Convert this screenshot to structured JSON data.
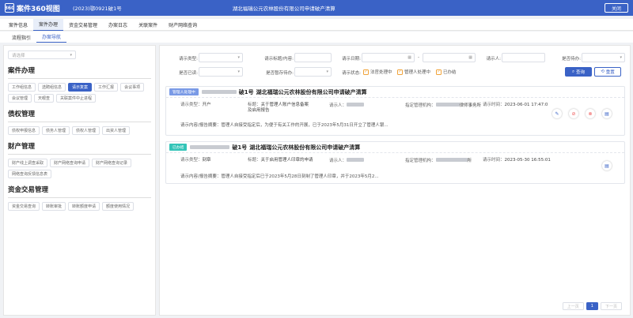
{
  "header": {
    "logo_mark": "360",
    "app_title": "案件360视图",
    "case_number": "(2023)鄂0921破1号",
    "case_name": "湖北福瑞公元农林股份有限公司申请破产清算",
    "close_label": "关闭"
  },
  "tabs": [
    "案件信息",
    "案件办理",
    "资金交易管理",
    "办案日志",
    "关联案件",
    "财产网络查询"
  ],
  "active_tab_index": 1,
  "subtabs": [
    "流程指引",
    "办案导航"
  ],
  "active_subtab_index": 1,
  "left": {
    "filter_placeholder": "请选择",
    "sections": [
      {
        "title": "案件办理",
        "items": [
          "工作组信息",
          "选聘组信息",
          "请示复案",
          "工作汇报",
          "会议事项",
          "会议管理",
          "天眼查",
          "关联案件中止进程"
        ]
      },
      {
        "title": "债权管理",
        "items": [
          "债权申报信息",
          "债务人管理",
          "债权人管理",
          "出资人管理"
        ]
      },
      {
        "title": "财产管理",
        "items": [
          "财产线上调查采取",
          "财产网络查询申请",
          "财产网络查询记录",
          "网络查询反馈信息表"
        ]
      },
      {
        "title": "资金交易管理",
        "items": [
          "资金交易查询",
          "转账审批",
          "转账额度申请",
          "额度使用情况"
        ]
      }
    ],
    "active_item": "请示复案"
  },
  "filters": {
    "request_type_label": "请示类型:",
    "title_content_label": "请示标题/内容:",
    "request_date_label": "请示日期:",
    "date_separator": "-",
    "requester_label": "请示人:",
    "pending_label": "是否待办:",
    "read_label": "是否已读:",
    "paused_pending_label": "是否暂存待办:",
    "status_label": "请示状态:",
    "status_options": [
      "法官处理中",
      "管理人处理中",
      "已办结"
    ],
    "search_label": "查询",
    "reset_label": "重置"
  },
  "cards": [
    {
      "badge": "管理人处理中",
      "badge_color": "#7a9ae6",
      "title_suffix": "破1号",
      "title_case_name": "湖北福瑞公元农林股份有限公司申请破产清算",
      "type_label": "请示类型：",
      "type_value": "开户",
      "subject_label": "标题：",
      "subject_value": "关于管理人账户信息备案及启用报告",
      "requester_label": "请示人：",
      "org_label": "指定管理机构：",
      "org_value": "律师事务所",
      "time_label": "请示时间：",
      "time_value": "2023-06-01 17:47:0",
      "abstract_label": "请示内容/报告摘要：",
      "abstract_value": "管理人自接受指定后，为便于有关工作的开展，已于2023年5月31日开立了管理人银..."
    },
    {
      "badge": "已办结",
      "badge_color": "#33c4b8",
      "title_suffix": "破1号",
      "title_case_name": "湖北福瑞公元农林股份有限公司申请破产清算",
      "type_label": "请示类型：",
      "type_value": "刻章",
      "subject_label": "标题：",
      "subject_value": "关于启用管理人印章的申请",
      "requester_label": "请示人：",
      "org_label": "指定管理机构：",
      "org_value": "所",
      "time_label": "请示时间：",
      "time_value": "2023-05-30 16:55:01",
      "abstract_label": "请示内容/报告摘要：",
      "abstract_value": "管理人自接受指定后已于2023年5月28日刻制了管理人印章，并于2023年5月2..."
    }
  ],
  "pager": {
    "prev": "上一页",
    "current": "1",
    "next": "下一页"
  },
  "colors": {
    "primary": "#3a62c6",
    "checkbox": "#f0a33a"
  }
}
